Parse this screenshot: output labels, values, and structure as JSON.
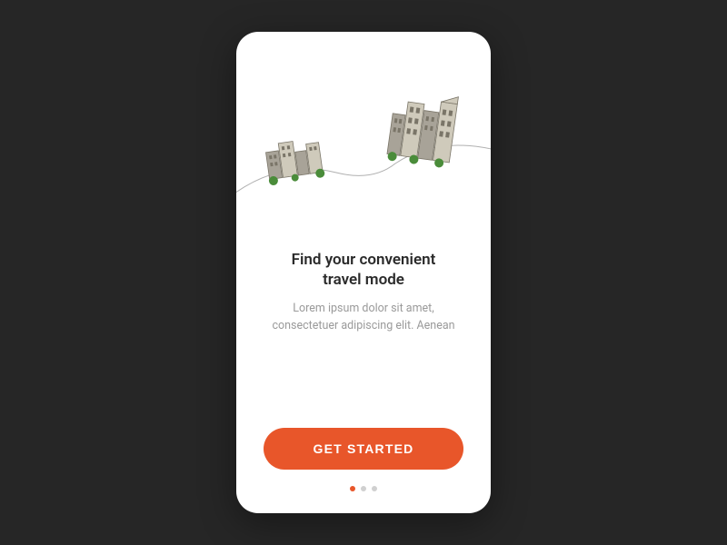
{
  "onboarding": {
    "heading": "Find your convenient travel mode",
    "subtext": "Lorem ipsum dolor sit amet, consectetuer adipiscing elit. Aenean",
    "cta_label": "GET STARTED",
    "colors": {
      "accent": "#e8562a",
      "background": "#262626",
      "card": "#ffffff",
      "text_dark": "#2a2a2a",
      "text_muted": "#9a9a9a"
    },
    "pagination": {
      "total": 3,
      "active_index": 0
    }
  }
}
